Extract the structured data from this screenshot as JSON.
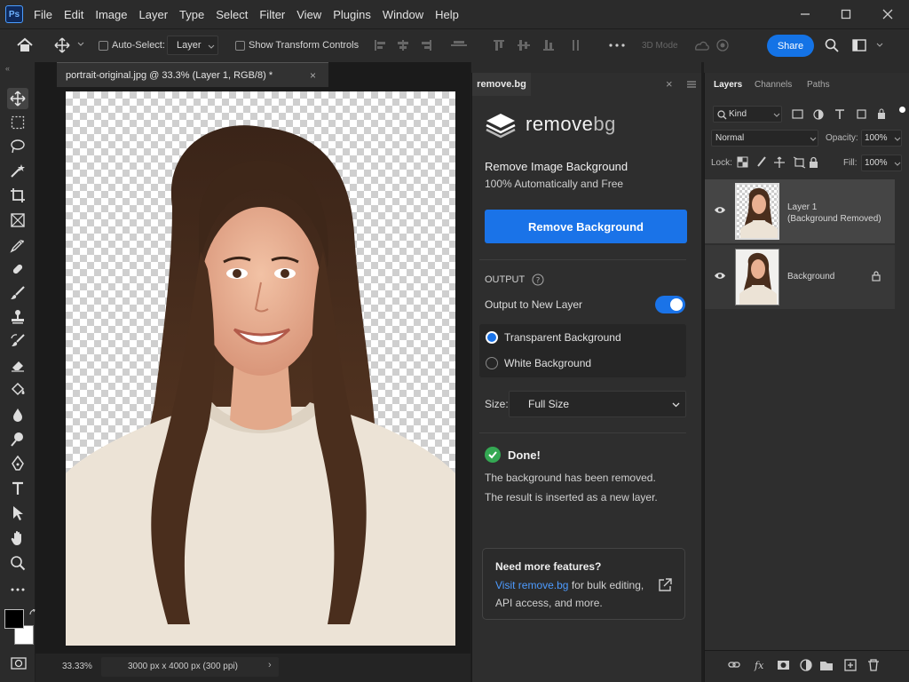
{
  "app": {
    "logo": "Ps"
  },
  "menu": [
    "File",
    "Edit",
    "Image",
    "Layer",
    "Type",
    "Select",
    "Filter",
    "View",
    "Plugins",
    "Window",
    "Help"
  ],
  "options": {
    "auto_select": "Auto-Select:",
    "layer_dropdown": "Layer",
    "show_transform": "Show Transform Controls",
    "mode_3d": "3D Mode",
    "share": "Share"
  },
  "document": {
    "tab_title": "portrait-original.jpg @ 33.3% (Layer 1, RGB/8) *",
    "zoom": "33.33%",
    "dimensions": "3000 px x 4000 px (300 ppi)"
  },
  "plugin": {
    "tab_label": "remove.bg",
    "logo_text_main": "remove",
    "logo_text_accent": "bg",
    "heading": "Remove Image Background",
    "subheading": "100% Automatically and Free",
    "remove_button": "Remove Background",
    "output_label": "OUTPUT",
    "output_new_layer": "Output to New Layer",
    "output_new_layer_on": true,
    "option_transparent": "Transparent Background",
    "option_white": "White Background",
    "size_label": "Size:",
    "size_value": "Full Size",
    "done_title": "Done!",
    "done_line1": "The background has been removed.",
    "done_line2": "The result is inserted as a new layer.",
    "more_title": "Need more features?",
    "more_link": "Visit remove.bg",
    "more_text1": " for bulk editing,",
    "more_text2": "API access, and more."
  },
  "layers_panel": {
    "tabs": [
      "Layers",
      "Channels",
      "Paths"
    ],
    "filter_kind": "Kind",
    "blend_mode": "Normal",
    "opacity_label": "Opacity:",
    "opacity_value": "100%",
    "lock_label": "Lock:",
    "fill_label": "Fill:",
    "fill_value": "100%",
    "layers": [
      {
        "name_line1": "Layer 1",
        "name_line2": "(Background Removed)"
      },
      {
        "name_line1": "Background"
      }
    ]
  },
  "colors": {
    "accent": "#1a73e8",
    "success": "#34a853",
    "panel": "#2e2e2e"
  }
}
